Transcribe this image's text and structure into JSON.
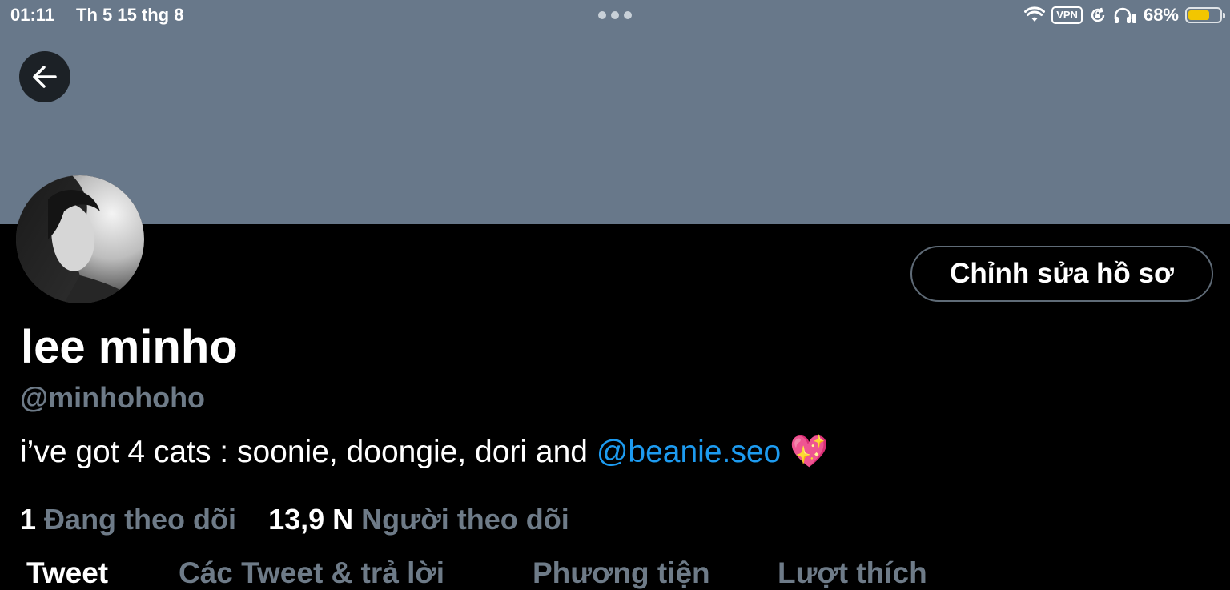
{
  "status_bar": {
    "time": "01:11",
    "date": "Th 5 15 thg 8",
    "vpn": "VPN",
    "battery_pct": "68%",
    "battery_level": 0.68
  },
  "profile": {
    "display_name": "lee minho",
    "handle": "@minhohoho",
    "bio_text": "i’ve got 4 cats : soonie, doongie, dori and ",
    "bio_mention": "@beanie.seo",
    "bio_emoji": "💖",
    "edit_button_label": "Chỉnh sửa hồ sơ"
  },
  "stats": {
    "following_count": "1",
    "following_label": "Đang theo dõi",
    "followers_count": "13,9 N",
    "followers_label": "Người theo dõi"
  },
  "tabs": [
    {
      "label": "Tweet",
      "active": true
    },
    {
      "label": "Các Tweet & trả lời",
      "active": false
    },
    {
      "label": "Phương tiện",
      "active": false
    },
    {
      "label": "Lượt thích",
      "active": false
    }
  ],
  "colors": {
    "banner": "#68788a",
    "link": "#1d9bf0",
    "muted": "#6e7b88"
  }
}
